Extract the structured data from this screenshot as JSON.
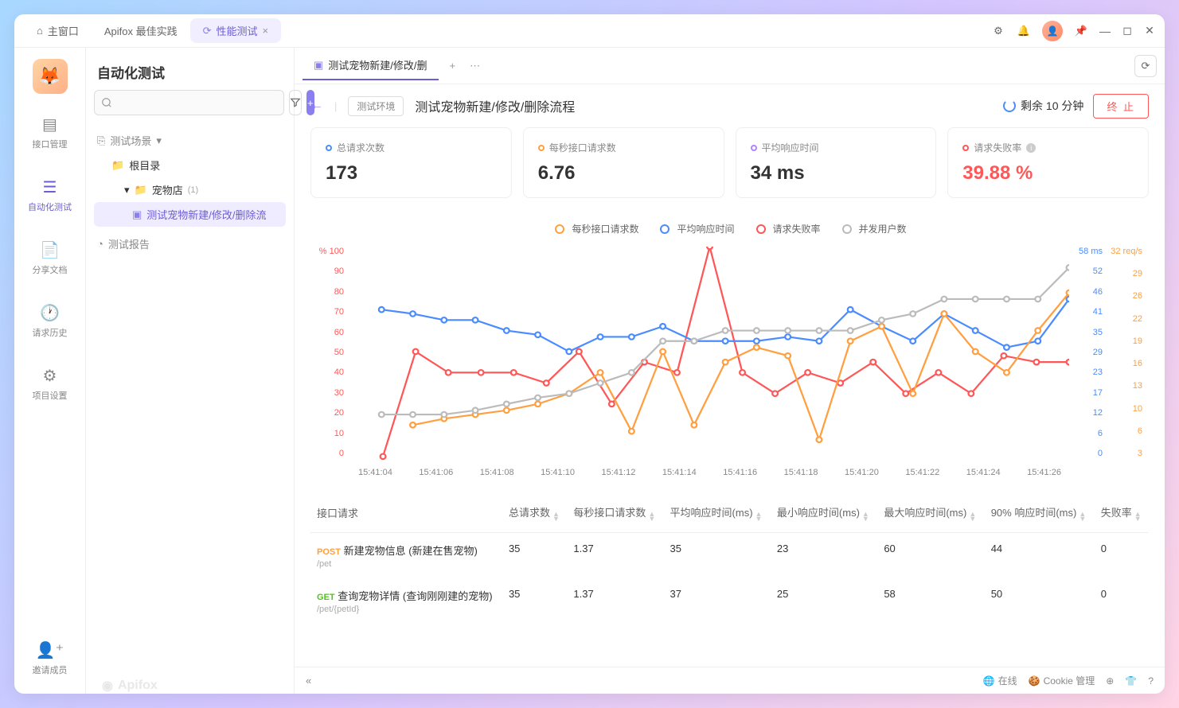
{
  "titlebar": {
    "tabs": [
      {
        "icon": "⌂",
        "label": "主窗口"
      },
      {
        "label": "Apifox 最佳实践"
      },
      {
        "icon": "⟳",
        "label": "性能测试",
        "active": true,
        "closable": true
      }
    ]
  },
  "nav": {
    "items": [
      {
        "icon": "▤",
        "label": "接口管理"
      },
      {
        "icon": "☰",
        "label": "自动化测试",
        "active": true
      },
      {
        "icon": "📄",
        "label": "分享文档"
      },
      {
        "icon": "🕐",
        "label": "请求历史"
      },
      {
        "icon": "⚙",
        "label": "项目设置"
      }
    ],
    "invite": {
      "icon": "👤⁺",
      "label": "邀请成员"
    }
  },
  "sidebar": {
    "title": "自动化测试",
    "search_placeholder": "",
    "tree_head": "测试场景",
    "tree": [
      {
        "icon": "📁",
        "label": "根目录",
        "indent": 1
      },
      {
        "icon": "📁",
        "label": "宠物店",
        "count": "(1)",
        "indent": 2,
        "expand": "▾"
      },
      {
        "icon": "▣",
        "label": "测试宠物新建/修改/删除流",
        "indent": 3,
        "selected": true
      }
    ],
    "reports": "测试报告"
  },
  "page_tab": {
    "icon": "▣",
    "label": "测试宠物新建/修改/删"
  },
  "breadcrumb": {
    "env": "测试环境",
    "title": "测试宠物新建/修改/删除流程",
    "remaining": "剩余 10 分钟",
    "stop": "终 止"
  },
  "stats": [
    {
      "label": "总请求次数",
      "value": "173",
      "dot": "blue"
    },
    {
      "label": "每秒接口请求数",
      "value": "6.76",
      "dot": "orange"
    },
    {
      "label": "平均响应时间",
      "value": "34 ms",
      "dot": "purple"
    },
    {
      "label": "请求失败率",
      "value": "39.88 %",
      "dot": "red",
      "red": true
    }
  ],
  "chart_data": {
    "type": "line",
    "legend": [
      "每秒接口请求数",
      "平均响应时间",
      "请求失败率",
      "并发用户数"
    ],
    "colors": {
      "每秒接口请求数": "#ff9f40",
      "平均响应时间": "#4a8cff",
      "请求失败率": "#ff5757",
      "并发用户数": "#bbb"
    },
    "x": [
      "15:41:04",
      "15:41:06",
      "15:41:08",
      "15:41:10",
      "15:41:12",
      "15:41:14",
      "15:41:16",
      "15:41:18",
      "15:41:20",
      "15:41:22",
      "15:41:24",
      "15:41:26"
    ],
    "y_left": {
      "label": "%",
      "ticks": [
        0,
        10,
        20,
        30,
        40,
        50,
        60,
        70,
        80,
        90,
        100
      ],
      "color": "#ff5757"
    },
    "y_right_1": {
      "unit": "ms",
      "ticks": [
        0,
        6,
        12,
        17,
        23,
        29,
        35,
        41,
        46,
        52,
        58
      ],
      "color": "#4a8cff"
    },
    "y_right_2": {
      "unit": "req/s",
      "ticks": [
        3,
        6,
        10,
        13,
        16,
        19,
        22,
        26,
        29,
        32
      ],
      "color": "#ff9f40"
    },
    "series": [
      {
        "name": "请求失败率",
        "values": [
          null,
          0,
          50,
          40,
          40,
          40,
          35,
          50,
          25,
          45,
          40,
          100,
          40,
          30,
          40,
          35,
          45,
          30,
          40,
          30,
          48,
          45,
          45
        ]
      },
      {
        "name": "平均响应时间",
        "values": [
          null,
          70,
          68,
          65,
          65,
          60,
          58,
          50,
          57,
          57,
          62,
          55,
          55,
          55,
          57,
          55,
          70,
          62,
          55,
          68,
          60,
          52,
          55,
          75
        ]
      },
      {
        "name": "每秒接口请求数",
        "values": [
          null,
          null,
          15,
          18,
          20,
          22,
          25,
          30,
          40,
          12,
          50,
          15,
          45,
          52,
          48,
          8,
          55,
          62,
          30,
          68,
          50,
          40,
          60,
          78
        ]
      },
      {
        "name": "并发用户数",
        "values": [
          null,
          20,
          20,
          20,
          22,
          25,
          28,
          30,
          35,
          40,
          55,
          55,
          60,
          60,
          60,
          60,
          60,
          65,
          68,
          75,
          75,
          75,
          75,
          90
        ]
      }
    ]
  },
  "table": {
    "columns": [
      "接口请求",
      "总请求数",
      "每秒接口请求数",
      "平均响应时间(ms)",
      "最小响应时间(ms)",
      "最大响应时间(ms)",
      "90% 响应时间(ms)",
      "失败率"
    ],
    "rows": [
      {
        "method": "POST",
        "name": "新建宠物信息 (新建在售宠物)",
        "path": "/pet",
        "cells": [
          "35",
          "1.37",
          "35",
          "23",
          "60",
          "44",
          "0"
        ]
      },
      {
        "method": "GET",
        "name": "查询宠物详情 (查询刚刚建的宠物)",
        "path": "/pet/{petId}",
        "cells": [
          "35",
          "1.37",
          "37",
          "25",
          "58",
          "50",
          "0"
        ]
      }
    ]
  },
  "footer": {
    "online": "在线",
    "cookie": "Cookie 管理"
  },
  "watermark": "Apifox"
}
